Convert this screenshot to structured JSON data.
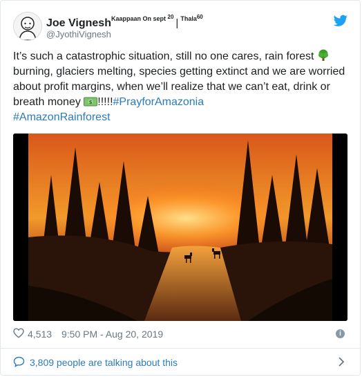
{
  "tweet": {
    "author": {
      "name": "Joe Vignesh",
      "sup_left": "Kaappaan On sept",
      "sup_num": "20",
      "sep": "|",
      "sup_right": "Thala",
      "sup_right_num": "60",
      "handle": "@JyothiVignesh",
      "avatar_icon": "avatar"
    },
    "text": {
      "line1": "It’s such a catastrophic situation, still no one cares, rain forest ",
      "line2": "burning, glaciers melting, species getting extinct and we are worried about profit margins, when we’ll realize that we can’t eat, drink or breath money ",
      "exclaim": "!!!!!",
      "hashtag1": "#PrayforAmazonia",
      "hashtag2": "#AmazonRainforest",
      "emoji1": "deciduous-tree-emoji",
      "emoji2": "dollar-banknote-emoji"
    },
    "media": {
      "icon": "forest-fire-photo"
    },
    "meta": {
      "likes": "4,513",
      "timestamp": "9:50 PM - Aug 20, 2019",
      "info_glyph": "i"
    },
    "footer": {
      "talking": "3,809 people are talking about this"
    },
    "colors": {
      "link": "#2b7bb9",
      "text": "#1c2022",
      "muted": "#697882",
      "twitter": "#1da1f2"
    }
  }
}
